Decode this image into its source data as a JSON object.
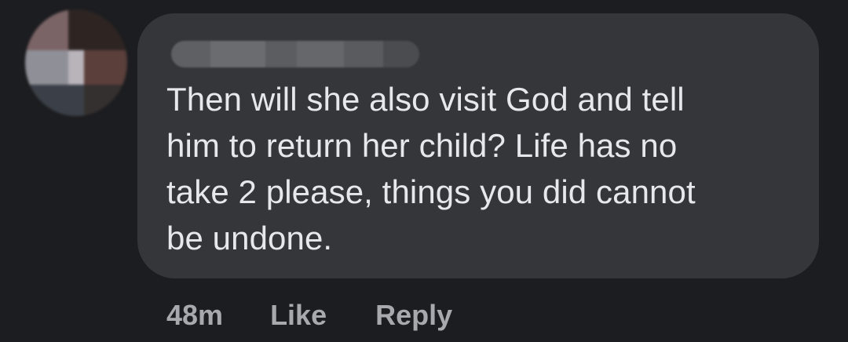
{
  "comment": {
    "author_name": "",
    "text": "Then will she also visit God and tell\nhim to return her child? Life has no\ntake 2 please, things you did cannot\nbe undone.",
    "timestamp": "48m",
    "like_label": "Like",
    "reply_label": "Reply"
  },
  "colors": {
    "background": "#1c1d20",
    "bubble": "#35363a",
    "text": "#e7e8ec",
    "meta_text": "#a7a9ae"
  }
}
